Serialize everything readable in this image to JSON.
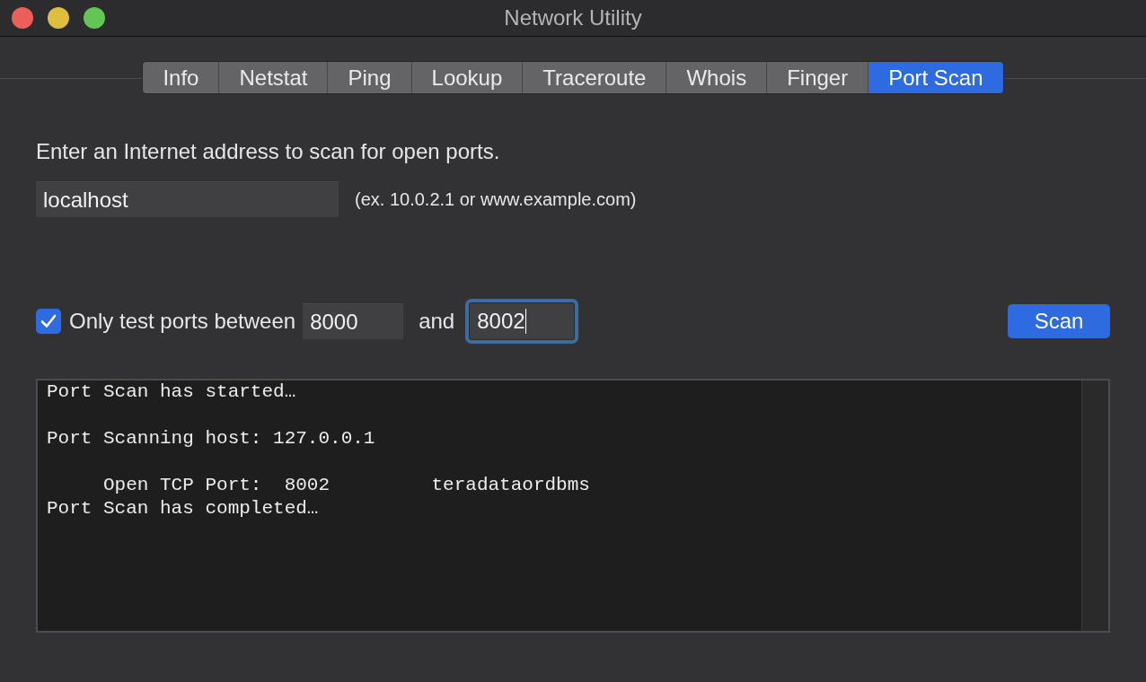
{
  "window": {
    "title": "Network Utility"
  },
  "tabs": [
    {
      "label": "Info",
      "selected": false
    },
    {
      "label": "Netstat",
      "selected": false
    },
    {
      "label": "Ping",
      "selected": false
    },
    {
      "label": "Lookup",
      "selected": false
    },
    {
      "label": "Traceroute",
      "selected": false
    },
    {
      "label": "Whois",
      "selected": false
    },
    {
      "label": "Finger",
      "selected": false
    },
    {
      "label": "Port Scan",
      "selected": true
    }
  ],
  "prompt": "Enter an Internet address to scan for open ports.",
  "address_field": {
    "value": "localhost",
    "focused": false
  },
  "address_hint": "(ex. 10.0.2.1 or www.example.com)",
  "port_range": {
    "checked": true,
    "label": "Only test ports between",
    "from": {
      "value": "8000",
      "focused": false
    },
    "joiner": "and",
    "to": {
      "value": "8002",
      "focused": true
    }
  },
  "scan_button": "Scan",
  "output": "Port Scan has started…\n\nPort Scanning host: 127.0.0.1\n\n     Open TCP Port:  8002         teradataordbms\nPort Scan has completed…"
}
